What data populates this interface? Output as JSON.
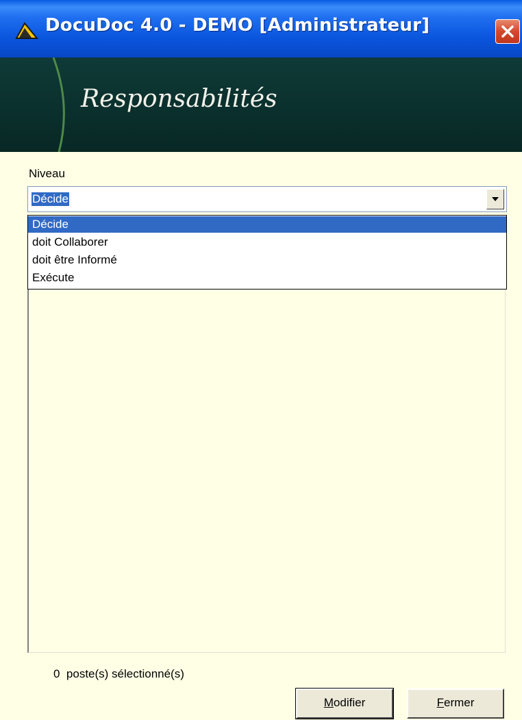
{
  "window": {
    "title": "DocuDoc 4.0 - DEMO [Administrateur]",
    "colors": {
      "titlebar": "#0A56DE",
      "banner": "#0B312E",
      "dialog_bg": "#FFFFE6",
      "selection": "#316AC5",
      "close": "#D4492C"
    }
  },
  "banner": {
    "title": "Responsabilités"
  },
  "niveau": {
    "label": "Niveau",
    "selected": "Décide",
    "options": [
      "Décide",
      "doit Collaborer",
      "doit être Informé",
      "Exécute"
    ]
  },
  "status": {
    "count": "0",
    "text": "poste(s) sélectionné(s)"
  },
  "buttons": {
    "modifier": {
      "accel": "M",
      "rest": "odifier"
    },
    "fermer": {
      "accel": "F",
      "rest": "ermer"
    }
  },
  "icons": {
    "app": "docudoc-logo-icon",
    "close": "close-icon",
    "dropdown": "chevron-down-icon"
  }
}
